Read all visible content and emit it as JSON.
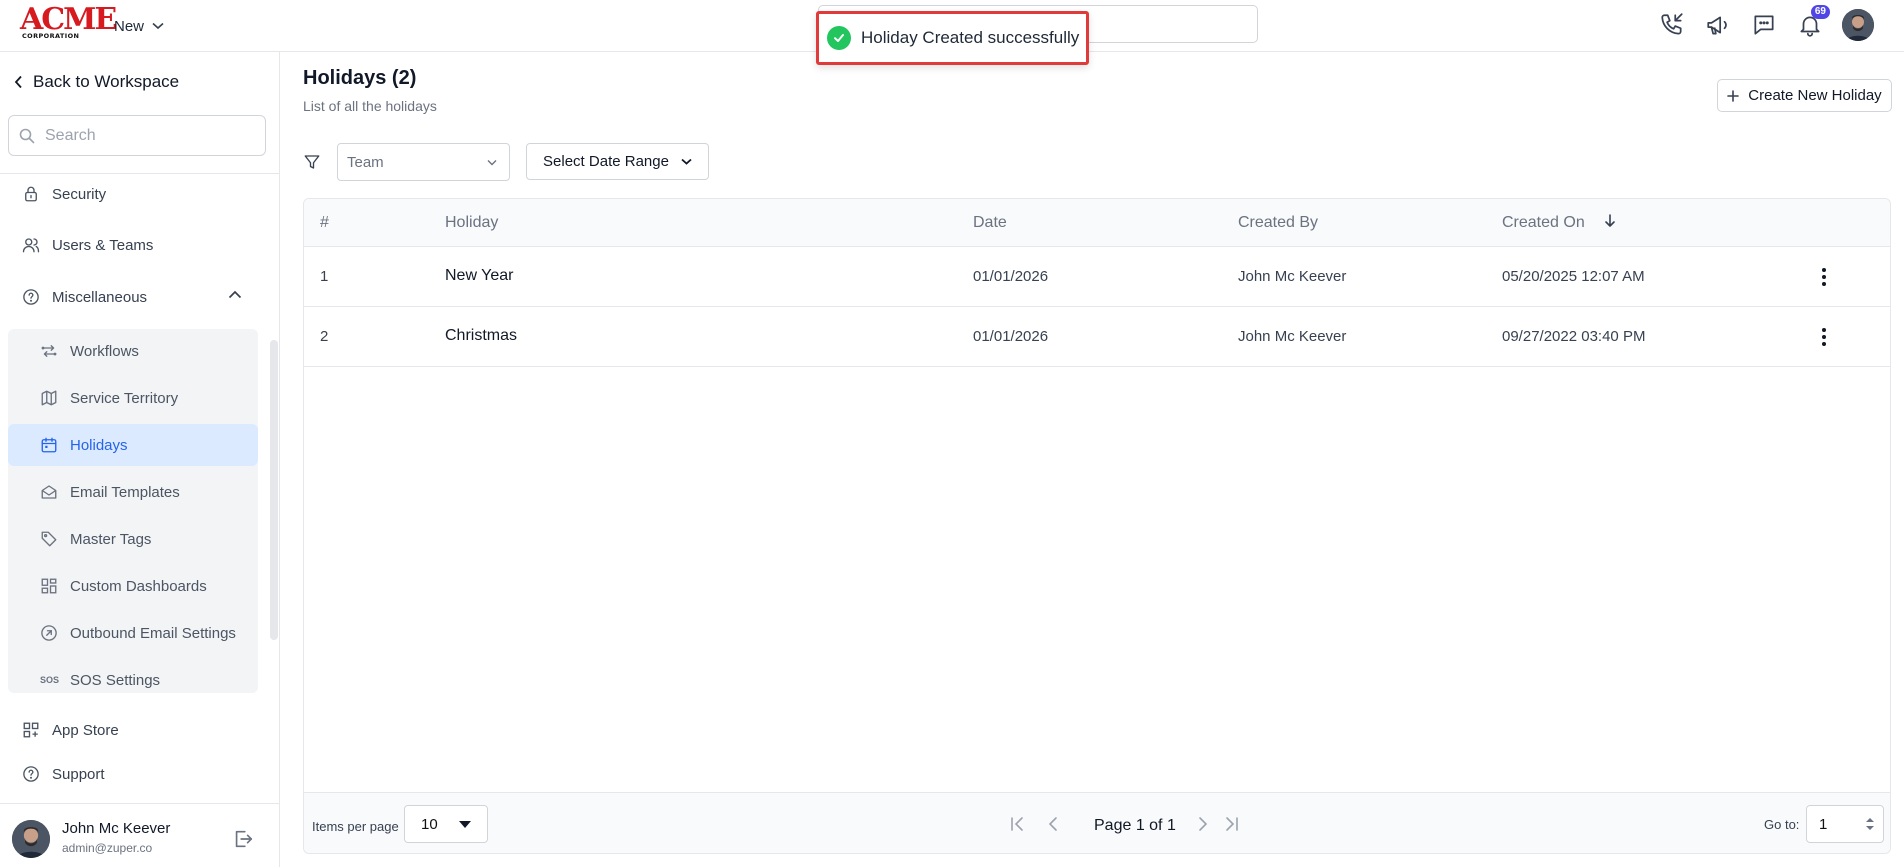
{
  "header": {
    "logo_text": "ACME",
    "logo_subtext": "CORPORATION",
    "new_label": "New",
    "notification_count": "69"
  },
  "toast": {
    "message": "Holiday Created successfully",
    "status_color": "#22c55e"
  },
  "sidebar": {
    "back_label": "Back to Workspace",
    "search_placeholder": "Search",
    "items": [
      {
        "label": "Security",
        "icon": "lock-icon"
      },
      {
        "label": "Users & Teams",
        "icon": "users-icon"
      },
      {
        "label": "Miscellaneous",
        "icon": "help-circle-icon",
        "expanded": true
      },
      {
        "label": "App Store",
        "icon": "grid-icon"
      },
      {
        "label": "Support",
        "icon": "help-circle-icon"
      }
    ],
    "sub_items": [
      {
        "label": "Workflows",
        "icon": "workflow-icon"
      },
      {
        "label": "Service Territory",
        "icon": "map-icon"
      },
      {
        "label": "Holidays",
        "icon": "calendar-icon",
        "active": true
      },
      {
        "label": "Email Templates",
        "icon": "envelope-icon"
      },
      {
        "label": "Master Tags",
        "icon": "tag-icon"
      },
      {
        "label": "Custom Dashboards",
        "icon": "dashboard-icon"
      },
      {
        "label": "Outbound Email Settings",
        "icon": "compass-icon"
      },
      {
        "label": "SOS Settings",
        "icon": "sos-icon",
        "icon_text": "SOS"
      }
    ],
    "user": {
      "name": "John Mc Keever",
      "email": "admin@zuper.co"
    }
  },
  "main": {
    "title": "Holidays (2)",
    "subtitle": "List of all the holidays",
    "create_button": "Create New Holiday",
    "team_filter": "Team",
    "date_range_button": "Select Date Range",
    "table": {
      "columns": [
        "#",
        "Holiday",
        "Date",
        "Created By",
        "Created On"
      ],
      "sort_column": "Created On",
      "rows": [
        {
          "index": "1",
          "holiday": "New Year",
          "date": "01/01/2026",
          "created_by": "John Mc Keever",
          "created_on": "05/20/2025 12:07 AM"
        },
        {
          "index": "2",
          "holiday": "Christmas",
          "date": "01/01/2026",
          "created_by": "John Mc Keever",
          "created_on": "09/27/2022 03:40 PM"
        }
      ]
    },
    "pagination": {
      "items_per_page_label": "Items per page",
      "items_per_page": "10",
      "page_label": "Page 1 of 1",
      "goto_label": "Go to:",
      "goto_value": "1"
    }
  },
  "colors": {
    "accent": "#2563eb",
    "active_bg": "#dbeafe",
    "toast_border": "#e03a3a",
    "badge": "#4f46e5",
    "logo": "#d71920"
  }
}
